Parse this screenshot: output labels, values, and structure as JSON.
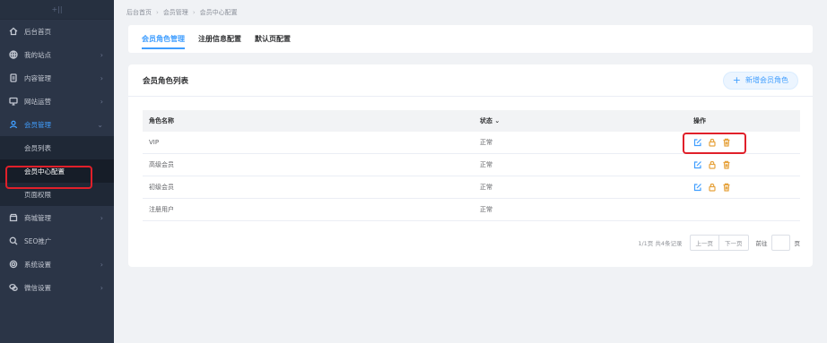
{
  "sidebar": {
    "top_glyph": "+||",
    "items": [
      {
        "label": "后台首页",
        "icon": "home-icon",
        "has_arrow": false
      },
      {
        "label": "我的站点",
        "icon": "globe-icon",
        "has_arrow": true
      },
      {
        "label": "内容管理",
        "icon": "document-icon",
        "has_arrow": true
      },
      {
        "label": "网站运营",
        "icon": "monitor-icon",
        "has_arrow": true
      },
      {
        "label": "会员管理",
        "icon": "user-icon",
        "has_arrow": true,
        "expanded": true
      },
      {
        "label": "商城管理",
        "icon": "store-icon",
        "has_arrow": true
      },
      {
        "label": "SEO推广",
        "icon": "search-icon",
        "has_arrow": false
      },
      {
        "label": "系统设置",
        "icon": "gear-icon",
        "has_arrow": true
      },
      {
        "label": "微信设置",
        "icon": "chat-icon",
        "has_arrow": true
      }
    ],
    "sub_items": [
      "会员列表",
      "会员中心配置",
      "页面权限"
    ],
    "selected_sub": "会员中心配置"
  },
  "breadcrumb": [
    "后台首页",
    "会员管理",
    "会员中心配置"
  ],
  "tabs": [
    {
      "label": "会员角色管理",
      "active": true
    },
    {
      "label": "注册信息配置",
      "active": false
    },
    {
      "label": "默认页配置",
      "active": false
    }
  ],
  "card": {
    "title": "会员角色列表",
    "add_button": "新增会员角色"
  },
  "table": {
    "headers": {
      "name": "角色名称",
      "status": "状态",
      "actions": "操作"
    },
    "rows": [
      {
        "name": "VIP",
        "status": "正常",
        "has_actions": true
      },
      {
        "name": "高级会员",
        "status": "正常",
        "has_actions": true
      },
      {
        "name": "初级会员",
        "status": "正常",
        "has_actions": true
      },
      {
        "name": "注册用户",
        "status": "正常",
        "has_actions": false
      }
    ]
  },
  "pager": {
    "info": "1/1页 共4条记录",
    "prev": "上一页",
    "next": "下一页",
    "goto": "前往",
    "unit": "页"
  },
  "colors": {
    "sidebar_bg": "#2b3547",
    "accent": "#409eff",
    "warning": "#e6a23c",
    "highlight_box": "#e0202a"
  }
}
